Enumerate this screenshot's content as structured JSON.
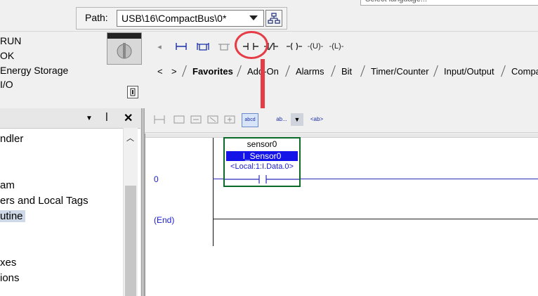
{
  "header": {
    "language_text": "Select language...",
    "path_label": "Path:",
    "path_value": "USB\\16\\CompactBus\\0*"
  },
  "status": {
    "lines": [
      "RUN",
      "OK",
      "Energy Storage",
      "I/O"
    ]
  },
  "instruction_toolbar": {
    "buttons": [
      "branch-start-icon",
      "branch-icon",
      "branch-level-icon",
      "xic-icon",
      "xio-icon",
      "ote-icon",
      "otu-icon",
      "otl-icon"
    ],
    "otu_label": "-(U)-",
    "otl_label": "-(L)-",
    "tabs": [
      "Favorites",
      "Add-On",
      "Alarms",
      "Bit",
      "Timer/Counter",
      "Input/Output",
      "Compa"
    ]
  },
  "tree": {
    "items": [
      "ndler",
      "am",
      "ers and Local Tags",
      "utine",
      "xes",
      "ions"
    ],
    "selected_index": 3
  },
  "ladder_toolbar": {
    "field_label_1": "abcd",
    "field_label_2": "ab...",
    "field_label_3": "<ab>"
  },
  "ladder": {
    "rung_number": "0",
    "end_label": "(End)",
    "instruction": {
      "operand_name": "sensor0",
      "tag": "I_Sensor0",
      "alias": "<Local:1:I.Data.0>"
    }
  },
  "colors": {
    "annotation": "#e53c46",
    "tag_highlight": "#1414e8",
    "box_border": "#0c6a28",
    "rung_text": "#1a1ad0"
  }
}
